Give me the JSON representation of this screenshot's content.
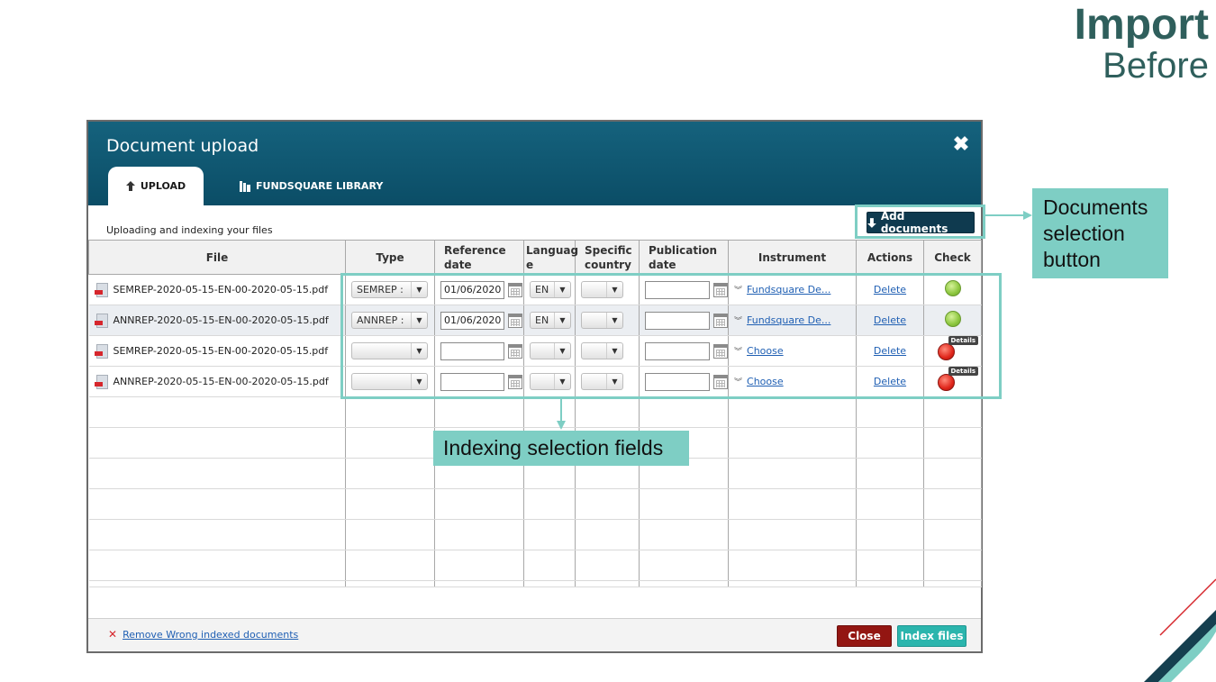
{
  "slide": {
    "title_line1": "Import",
    "title_line2": "Before"
  },
  "dialog": {
    "title": "Document upload",
    "close_glyph": "✖",
    "tabs": [
      {
        "label": "UPLOAD",
        "icon": "arrow-up-icon",
        "active": true
      },
      {
        "label": "FUNDSQUARE LIBRARY",
        "icon": "library-icon",
        "active": false
      }
    ],
    "subtitle": "Uploading and indexing your files",
    "add_documents_label": "Add documents",
    "columns": {
      "file": "File",
      "type": "Type",
      "reference_date": "Reference date",
      "language": "Languag e",
      "specific_country": "Specific country",
      "publication_date": "Publication date",
      "instrument": "Instrument",
      "actions": "Actions",
      "check": "Check"
    },
    "rows": [
      {
        "file": "SEMREP-2020-05-15-EN-00-2020-05-15.pdf",
        "type": "SEMREP :",
        "reference_date": "01/06/2020",
        "language": "EN",
        "specific_country": "",
        "publication_date": "",
        "instrument": "Fundsquare De...",
        "action": "Delete",
        "check": "ok"
      },
      {
        "file": "ANNREP-2020-05-15-EN-00-2020-05-15.pdf",
        "type": "ANNREP :",
        "reference_date": "01/06/2020",
        "language": "EN",
        "specific_country": "",
        "publication_date": "",
        "instrument": "Fundsquare De...",
        "action": "Delete",
        "check": "ok"
      },
      {
        "file": "SEMREP-2020-05-15-EN-00-2020-05-15.pdf",
        "type": "",
        "reference_date": "",
        "language": "",
        "specific_country": "",
        "publication_date": "",
        "instrument": "Choose",
        "action": "Delete",
        "check": "error",
        "details": "Details"
      },
      {
        "file": "ANNREP-2020-05-15-EN-00-2020-05-15.pdf",
        "type": "",
        "reference_date": "",
        "language": "",
        "specific_country": "",
        "publication_date": "",
        "instrument": "Choose",
        "action": "Delete",
        "check": "error",
        "details": "Details"
      }
    ],
    "empty_row_count": 7,
    "footer": {
      "remove_link": "Remove Wrong indexed documents",
      "close_label": "Close",
      "index_label": "Index files"
    }
  },
  "annotations": {
    "documents_selection": "Documents selection button",
    "indexing_fields": "Indexing selection fields",
    "accent_color": "#7ecec4"
  },
  "colors": {
    "header": "#0f5772",
    "title_text": "#2f5f5c",
    "close_button": "#931612",
    "index_button": "#2bb5ad"
  }
}
